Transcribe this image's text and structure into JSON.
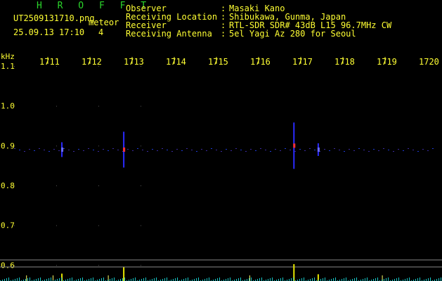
{
  "header": {
    "app_title": "H R O F F T",
    "filename": "UT2509131710.png",
    "meteor_label": "meteor",
    "datetime": "25.09.13 17:10",
    "meteor_count": "4",
    "fields": [
      {
        "label": "Observer",
        "value": "Masaki Kano"
      },
      {
        "label": "Receiving Location",
        "value": "Shibukawa, Gunma, Japan"
      },
      {
        "label": "Receiver",
        "value": "RTL-SDR SDR# 43dB L15 96.7MHz CW"
      },
      {
        "label": "Receiving Antenna",
        "value": "5el Yagi Az 280 for Seoul"
      }
    ],
    "colors": {
      "title": "#2bd62b",
      "text": "#ffff33"
    }
  },
  "chart_data": {
    "type": "heatmap",
    "ylabel": "kHz",
    "time_ticks": [
      "1711",
      "1712",
      "1713",
      "1714",
      "1715",
      "1716",
      "1717",
      "1718",
      "1719",
      "1720"
    ],
    "freq_ticks": [
      "1.1",
      "1.0",
      "0.9",
      "0.8",
      "0.7",
      "0.6"
    ],
    "ylim": [
      0.56,
      1.16
    ],
    "xlim": [
      17.1,
      17.2
    ],
    "grid": true,
    "meteor_echoes": [
      {
        "time": 17.114,
        "freq": 0.89,
        "strength": 0.25
      },
      {
        "time": 17.128,
        "freq": 0.89,
        "strength": 0.75
      },
      {
        "time": 17.1665,
        "freq": 0.9,
        "strength": 1.0
      },
      {
        "time": 17.172,
        "freq": 0.89,
        "strength": 0.2
      }
    ],
    "noise_spikes_minutes": [
      17.106,
      17.112,
      17.1245,
      17.1565,
      17.1865
    ]
  }
}
